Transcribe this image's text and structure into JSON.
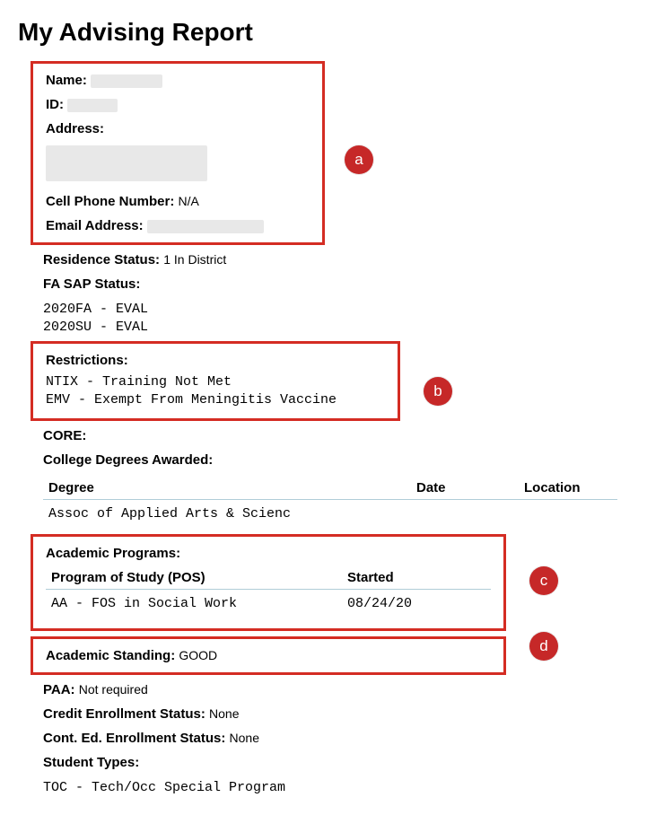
{
  "title": "My Advising Report",
  "personal": {
    "name_label": "Name:",
    "id_label": "ID:",
    "address_label": "Address:",
    "cell_label": "Cell Phone Number:",
    "cell_value": "N/A",
    "email_label": "Email Address:"
  },
  "residence": {
    "label": "Residence Status:",
    "value": "1 In District"
  },
  "fa_sap": {
    "label": "FA SAP Status:",
    "lines": "2020FA - EVAL\n2020SU - EVAL"
  },
  "restrictions": {
    "label": "Restrictions:",
    "lines": "NTIX - Training Not Met\nEMV - Exempt From Meningitis Vaccine"
  },
  "core": {
    "label": "CORE:"
  },
  "degrees": {
    "label": "College Degrees Awarded:",
    "headers": {
      "degree": "Degree",
      "date": "Date",
      "location": "Location"
    },
    "row": {
      "degree": "Assoc of Applied Arts & Scienc",
      "date": "",
      "location": ""
    }
  },
  "programs": {
    "label": "Academic Programs:",
    "headers": {
      "pos": "Program of Study (POS)",
      "started": "Started"
    },
    "row": {
      "pos": "AA - FOS in Social Work",
      "started": "08/24/20"
    }
  },
  "standing": {
    "label": "Academic Standing:",
    "value": "GOOD"
  },
  "paa": {
    "label": "PAA:",
    "value": "Not required"
  },
  "credit_enroll": {
    "label": "Credit Enrollment Status:",
    "value": "None"
  },
  "cont_ed": {
    "label": "Cont. Ed. Enrollment Status:",
    "value": "None"
  },
  "student_types": {
    "label": "Student Types:",
    "lines": "TOC - Tech/Occ Special Program"
  },
  "callouts": {
    "a": "a",
    "b": "b",
    "c": "c",
    "d": "d"
  }
}
